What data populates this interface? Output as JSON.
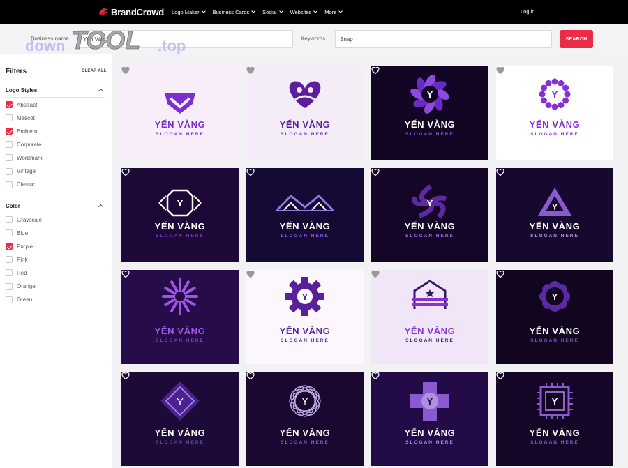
{
  "nav": {
    "brand": "BrandCrowd",
    "items": [
      {
        "label": "Logo Maker"
      },
      {
        "label": "Business Cards"
      },
      {
        "label": "Social"
      },
      {
        "label": "Websites"
      },
      {
        "label": "More"
      }
    ],
    "login": "Log in"
  },
  "search": {
    "business_name_label": "Business name",
    "business_name_value": "Yến Vàng",
    "keywords_label": "Keywords",
    "keywords_value": "Snap",
    "button_label": "SEARCH"
  },
  "watermark": {
    "text_a": "down",
    "text_b": "TOOL",
    "text_c": ".top"
  },
  "filters": {
    "title": "Filters",
    "clear_all": "CLEAR ALL",
    "logo_styles": {
      "title": "Logo Styles",
      "options": [
        {
          "label": "Abstract",
          "checked": true
        },
        {
          "label": "Mascot",
          "checked": false
        },
        {
          "label": "Emblem",
          "checked": true
        },
        {
          "label": "Corporate",
          "checked": false
        },
        {
          "label": "Wordmark",
          "checked": false
        },
        {
          "label": "Vintage",
          "checked": false
        },
        {
          "label": "Classic",
          "checked": false
        }
      ]
    },
    "color": {
      "title": "Color",
      "options": [
        {
          "label": "Grayscale",
          "checked": false
        },
        {
          "label": "Blue",
          "checked": false
        },
        {
          "label": "Purple",
          "checked": true
        },
        {
          "label": "Pink",
          "checked": false
        },
        {
          "label": "Red",
          "checked": false
        },
        {
          "label": "Orange",
          "checked": false
        },
        {
          "label": "Green",
          "checked": false
        }
      ]
    }
  },
  "logos": [
    {
      "brand": "YẾN VÀNG",
      "slogan": "SLOGAN HERE",
      "bg": "#f7eefa",
      "text": "#7b2fd0",
      "sloganColor": "#7b2fd0",
      "shape": "shield-icon"
    },
    {
      "brand": "YẾN VÀNG",
      "slogan": "SLOGAN HERE",
      "bg": "#f4edf8",
      "text": "#5b1f9e",
      "sloganColor": "#6f36b8",
      "shape": "heart-people-icon"
    },
    {
      "brand": "YẾN VÀNG",
      "slogan": "SLOGAN HERE",
      "bg": "#120624",
      "text": "#ffffff",
      "sloganColor": "#8e55e0",
      "shape": "swirl-emblem-icon"
    },
    {
      "brand": "YẾN VÀNG",
      "slogan": "SLOGAN HERE",
      "bg": "#ffffff",
      "text": "#8a2fd6",
      "sloganColor": "#8a2fd6",
      "shape": "dot-ring-icon"
    },
    {
      "brand": "YẾN VÀNG",
      "slogan": "SLOGAN HERE",
      "bg": "#1e0837",
      "text": "#ffffff",
      "sloganColor": "#6b3cb0",
      "shape": "octagon-frame-icon"
    },
    {
      "brand": "YẾN VÀNG",
      "slogan": "SLOGAN HERE",
      "bg": "#150a33",
      "text": "#ffffff",
      "sloganColor": "#8c5ce0",
      "shape": "rooftops-icon"
    },
    {
      "brand": "YẾN VÀNG",
      "slogan": "SLOGAN HERE",
      "bg": "#150526",
      "text": "#ffffff",
      "sloganColor": "#9b6ae6",
      "shape": "spiral-icon"
    },
    {
      "brand": "YẾN VÀNG",
      "slogan": "SLOGAN HERE",
      "bg": "#170830",
      "text": "#ffffff",
      "sloganColor": "#b39ad8",
      "shape": "triangle-icon"
    },
    {
      "brand": "YẾN VÀNG",
      "slogan": "SLOGAN HERE",
      "bg": "#260c48",
      "text": "#a05ae8",
      "sloganColor": "#7b48c0",
      "shape": "starburst-icon"
    },
    {
      "brand": "YẾN VÀNG",
      "slogan": "SLOGAN HERE",
      "bg": "#fbf7fd",
      "text": "#5a1f9a",
      "sloganColor": "#5a1f9a",
      "shape": "gear-icon"
    },
    {
      "brand": "YẾN VÀNG",
      "slogan": "SLOGAN HERE",
      "bg": "#f0e6f8",
      "text": "#8a2fd6",
      "sloganColor": "#3a1760",
      "shape": "barn-icon"
    },
    {
      "brand": "YẾN VÀNG",
      "slogan": "SLOGAN HERE",
      "bg": "#110520",
      "text": "#ffffff",
      "sloganColor": "#7c52c4",
      "shape": "flower-badge-icon"
    },
    {
      "brand": "YẾN VÀNG",
      "slogan": "SLOGAN HERE",
      "bg": "#1d0a38",
      "text": "#ffffff",
      "sloganColor": "#6b45a8",
      "shape": "diamond-icon"
    },
    {
      "brand": "YẾN VÀNG",
      "slogan": "SLOGAN HERE",
      "bg": "#1a0830",
      "text": "#ffffff",
      "sloganColor": "#8a5ad0",
      "shape": "wreath-icon"
    },
    {
      "brand": "YẾN VÀNG",
      "slogan": "SLOGAN HERE",
      "bg": "#220b46",
      "text": "#ffffff",
      "sloganColor": "#b08fe0",
      "shape": "cross-emblem-icon"
    },
    {
      "brand": "YẾN VÀNG",
      "slogan": "SLOGAN HERE",
      "bg": "#150628",
      "text": "#ffffff",
      "sloganColor": "#8a5ad0",
      "shape": "chip-icon"
    }
  ],
  "colors": {
    "accent": "#ee2b47",
    "nav_bg": "#000000"
  }
}
